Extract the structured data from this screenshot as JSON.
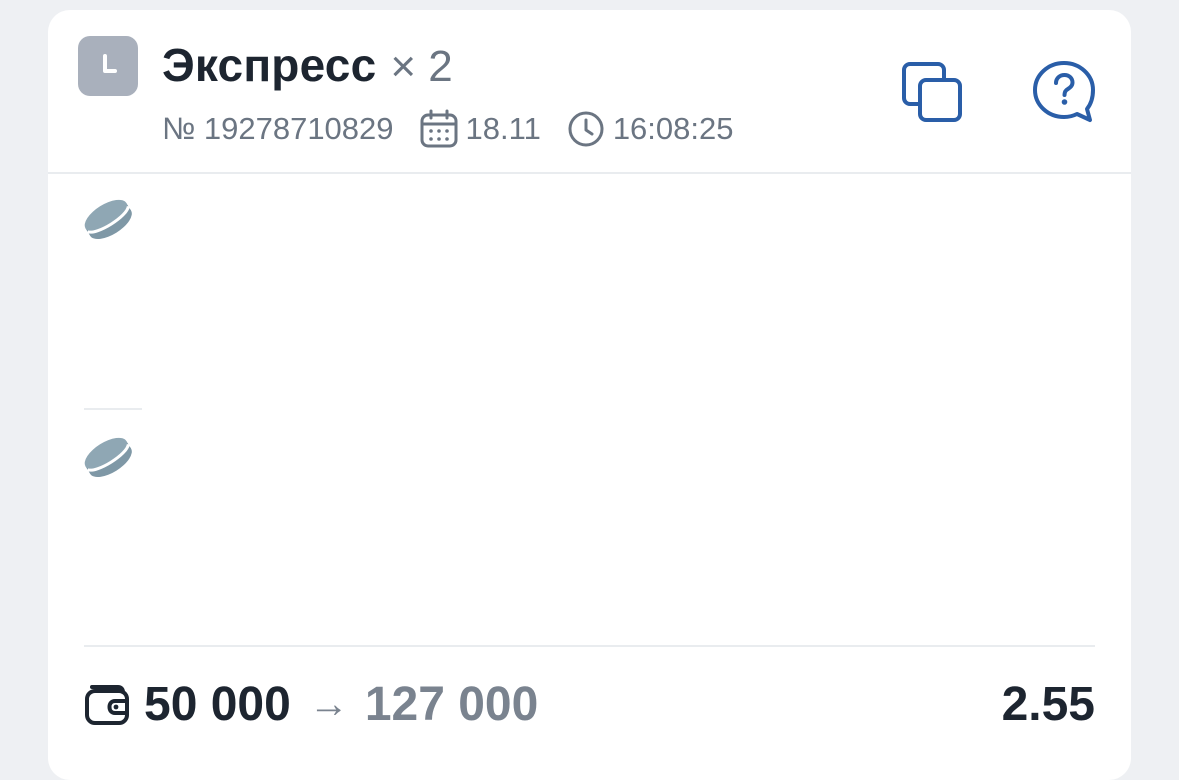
{
  "bet": {
    "type_label": "Экспресс",
    "multiplier": "× 2",
    "number": "№ 19278710829",
    "date": "18.11",
    "time": "16:08:25",
    "status_icon": "clock-icon",
    "status_color": "#a9b0bc"
  },
  "actions": {
    "copy_icon": "copy-icon",
    "help_icon": "help-chat-icon",
    "accent_color": "#2a5ea8"
  },
  "events": [
    {
      "sport_icon": "hockey-puck-icon"
    },
    {
      "sport_icon": "hockey-puck-icon"
    }
  ],
  "footer": {
    "wallet_icon": "wallet-icon",
    "stake": "50 000",
    "arrow": "→",
    "payout": "127 000",
    "odds": "2.55"
  }
}
